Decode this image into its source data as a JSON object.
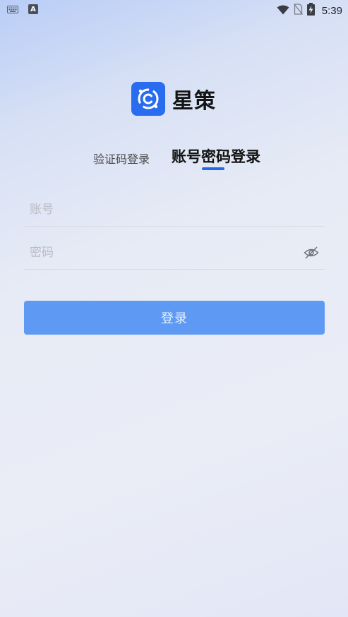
{
  "status_bar": {
    "time": "5:39",
    "left_icons": [
      "keyboard-icon",
      "a-notification-icon"
    ],
    "a_badge_text": "A",
    "right_icons": [
      "wifi-icon",
      "no-sim-icon",
      "battery-charging-icon"
    ]
  },
  "app": {
    "name": "星策",
    "logo_icon": "app-logo-icon",
    "brand_color": "#2a6cf0"
  },
  "tabs": {
    "sms_login": "验证码登录",
    "password_login": "账号密码登录",
    "active": "password_login",
    "accent_color": "#2468e8"
  },
  "form": {
    "account_placeholder": "账号",
    "account_value": "",
    "password_placeholder": "密码",
    "password_value": "",
    "password_toggle_icon": "eye-hidden-icon"
  },
  "login_button": {
    "label": "登录",
    "color": "#5e9af4"
  }
}
